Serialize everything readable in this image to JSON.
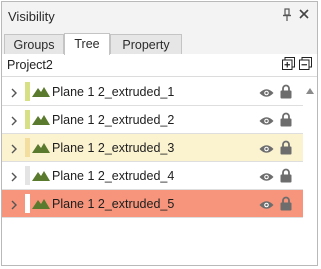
{
  "panel": {
    "title": "Visibility",
    "pin_icon": "pin-icon",
    "close_icon": "close-icon"
  },
  "tabs": [
    {
      "label": "Groups",
      "active": false
    },
    {
      "label": "Tree",
      "active": true
    },
    {
      "label": "Property",
      "active": false
    }
  ],
  "toolbar": {
    "project_name": "Project2",
    "expand_all_icon": "expand-all-icon",
    "collapse_all_icon": "collapse-all-icon"
  },
  "rows": [
    {
      "label": "Plane 1 2_extruded_1",
      "swatch": "#d8e085",
      "background": "#ffffff"
    },
    {
      "label": "Plane 1 2_extruded_2",
      "swatch": "#d8e085",
      "background": "#ffffff"
    },
    {
      "label": "Plane 1 2_extruded_3",
      "swatch": "#f3dea0",
      "background": "#fbf2d0"
    },
    {
      "label": "Plane 1 2_extruded_4",
      "swatch": "#e4e4e4",
      "background": "#ffffff"
    },
    {
      "label": "Plane 1 2_extruded_5",
      "swatch": "#ffffff",
      "background": "#f6957b"
    }
  ],
  "colors": {
    "mountain_icon": "#5a7a2e",
    "eye_icon": "#6d6d6d",
    "lock_icon": "#6d6d6d",
    "selected_row": "#f6957b",
    "highlighted_row": "#fbf2d0"
  },
  "icons": {
    "expander": "chevron-right-icon",
    "object": "mountain-icon",
    "visibility": "eye-icon",
    "lock": "lock-icon",
    "scroll": "scroll-up-arrow-icon"
  }
}
